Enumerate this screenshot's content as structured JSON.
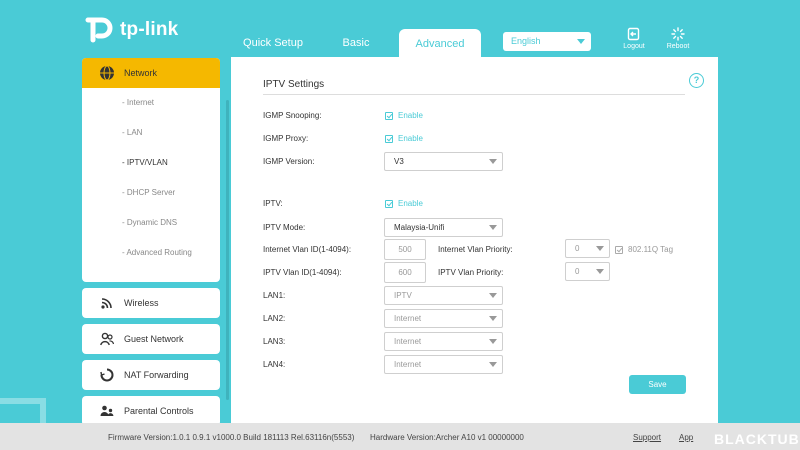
{
  "brand": {
    "name": "tp-link",
    "accent": "#4acbd6",
    "highlight": "#f5b800"
  },
  "tabs": [
    {
      "label": "Quick Setup"
    },
    {
      "label": "Basic"
    },
    {
      "label": "Advanced",
      "active": true
    }
  ],
  "language": {
    "selected": "English"
  },
  "header_buttons": {
    "logout": "Logout",
    "reboot": "Reboot"
  },
  "sidebar": {
    "network": {
      "label": "Network",
      "subitems": [
        "- Internet",
        "- LAN",
        "- IPTV/VLAN",
        "- DHCP Server",
        "- Dynamic DNS",
        "- Advanced Routing"
      ],
      "active_subitem": "- IPTV/VLAN"
    },
    "items": [
      {
        "label": "Wireless",
        "icon": "wifi-icon"
      },
      {
        "label": "Guest Network",
        "icon": "users-icon"
      },
      {
        "label": "NAT Forwarding",
        "icon": "nat-icon"
      },
      {
        "label": "Parental Controls",
        "icon": "parental-icon"
      }
    ]
  },
  "main": {
    "title": "IPTV Settings",
    "igmp_snooping": {
      "label": "IGMP Snooping:",
      "check_label": "Enable",
      "checked": true
    },
    "igmp_proxy": {
      "label": "IGMP Proxy:",
      "check_label": "Enable",
      "checked": true
    },
    "igmp_version": {
      "label": "IGMP Version:",
      "value": "V3"
    },
    "iptv": {
      "label": "IPTV:",
      "check_label": "Enable",
      "checked": true
    },
    "iptv_mode": {
      "label": "IPTV Mode:",
      "value": "Malaysia-Unifi"
    },
    "internet_vlan_id": {
      "label": "Internet Vlan ID(1-4094):",
      "value": "500"
    },
    "internet_vlan_priority": {
      "label": "Internet Vlan Priority:",
      "value": "0"
    },
    "tag_8021q": {
      "label": "802.11Q Tag",
      "checked": true
    },
    "iptv_vlan_id": {
      "label": "IPTV Vlan ID(1-4094):",
      "value": "600"
    },
    "iptv_vlan_priority": {
      "label": "IPTV Vlan Priority:",
      "value": "0"
    },
    "lan1": {
      "label": "LAN1:",
      "value": "IPTV"
    },
    "lan2": {
      "label": "LAN2:",
      "value": "Internet"
    },
    "lan3": {
      "label": "LAN3:",
      "value": "Internet"
    },
    "lan4": {
      "label": "LAN4:",
      "value": "Internet"
    },
    "save_label": "Save"
  },
  "footer": {
    "firmware": "Firmware Version:1.0.1 0.9.1 v1000.0 Build 181113 Rel.63116n(5553)",
    "hardware": "Hardware Version:Archer A10 v1 00000000",
    "support": "Support",
    "app": "App"
  },
  "watermark": "BLACKTUBI"
}
